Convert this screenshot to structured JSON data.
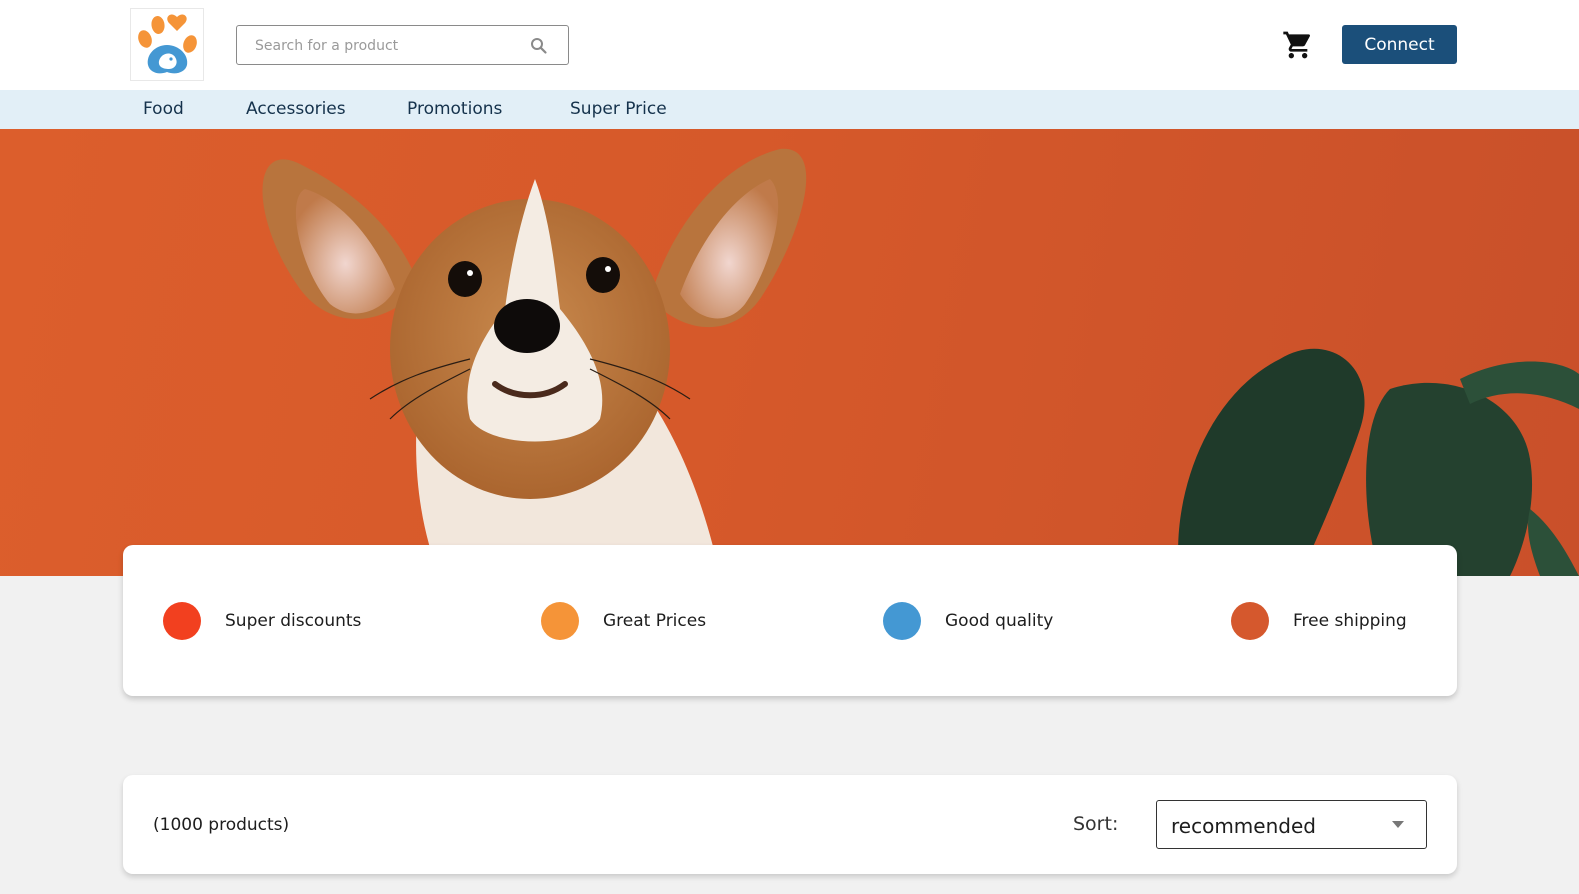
{
  "header": {
    "logo_name": "paw-logo",
    "search": {
      "placeholder": "Search for a product",
      "value": ""
    },
    "connect_label": "Connect"
  },
  "nav": {
    "items": [
      {
        "label": "Food"
      },
      {
        "label": "Accessories"
      },
      {
        "label": "Promotions"
      },
      {
        "label": "Super Price"
      }
    ]
  },
  "features": [
    {
      "label": "Super discounts",
      "color": "#f2401f"
    },
    {
      "label": "Great Prices",
      "color": "#f59438"
    },
    {
      "label": "Good quality",
      "color": "#4498d3"
    },
    {
      "label": "Free shipping",
      "color": "#d5582d"
    }
  ],
  "products": {
    "count_label": "(1000 products)",
    "sort_label": "Sort:",
    "sort_value": "recommended"
  },
  "colors": {
    "brand": "#1b4f7a",
    "nav_bg": "#e2eff7",
    "hero_bg": "#d6592a"
  }
}
